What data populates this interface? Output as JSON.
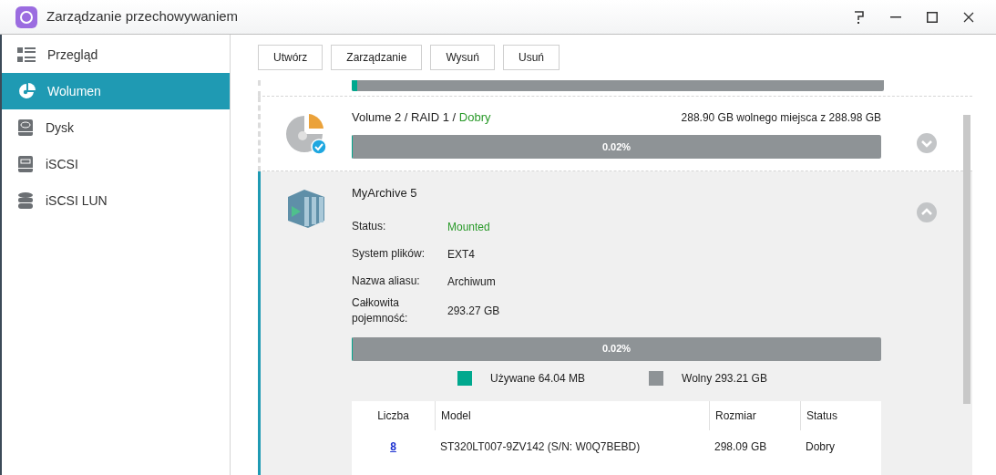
{
  "window": {
    "title": "Zarządzanie przechowywaniem"
  },
  "sidebar": {
    "items": [
      {
        "label": "Przegląd",
        "selected": false
      },
      {
        "label": "Wolumen",
        "selected": true
      },
      {
        "label": "Dysk",
        "selected": false
      },
      {
        "label": "iSCSI",
        "selected": false
      },
      {
        "label": "iSCSI LUN",
        "selected": false
      }
    ]
  },
  "toolbar": {
    "buttons": [
      "Utwórz",
      "Zarządzanie",
      "Wysuń",
      "Usuń"
    ]
  },
  "volumes": [
    {
      "kind": "partial",
      "level": 0.01
    },
    {
      "kind": "summary",
      "title": "Volume 2 / RAID 1 /",
      "status": "Dobry",
      "free_space": "288.90 GB wolnego miejsca z 288.98 GB",
      "usage": "0.02%",
      "level": 0.0002,
      "expanded": false
    },
    {
      "kind": "detail",
      "title": "MyArchive 5",
      "expanded": true,
      "details": [
        {
          "kind": "status",
          "label": "Status:",
          "value": "Mounted"
        },
        {
          "kind": "text",
          "label": "System plików:",
          "value": "EXT4"
        },
        {
          "kind": "text",
          "label": "Nazwa aliasu:",
          "value": "Archiwum"
        },
        {
          "kind": "text",
          "label": "Całkowita pojemność:",
          "value": "293.27 GB"
        }
      ],
      "usage": "0.02%",
      "level": 0.0002,
      "legend": [
        {
          "label": "Używane 64.04 MB",
          "color": "#00a88e"
        },
        {
          "label": "Wolny 293.21 GB",
          "color": "#8e9396"
        }
      ],
      "table": {
        "columns": [
          "Liczba",
          "Model",
          "Rozmiar",
          "Status"
        ],
        "rows": [
          [
            "8",
            "ST320LT007-9ZV142 (S/N: W0Q7BEBD)",
            "298.09 GB",
            "Dobry"
          ]
        ]
      }
    }
  ]
}
